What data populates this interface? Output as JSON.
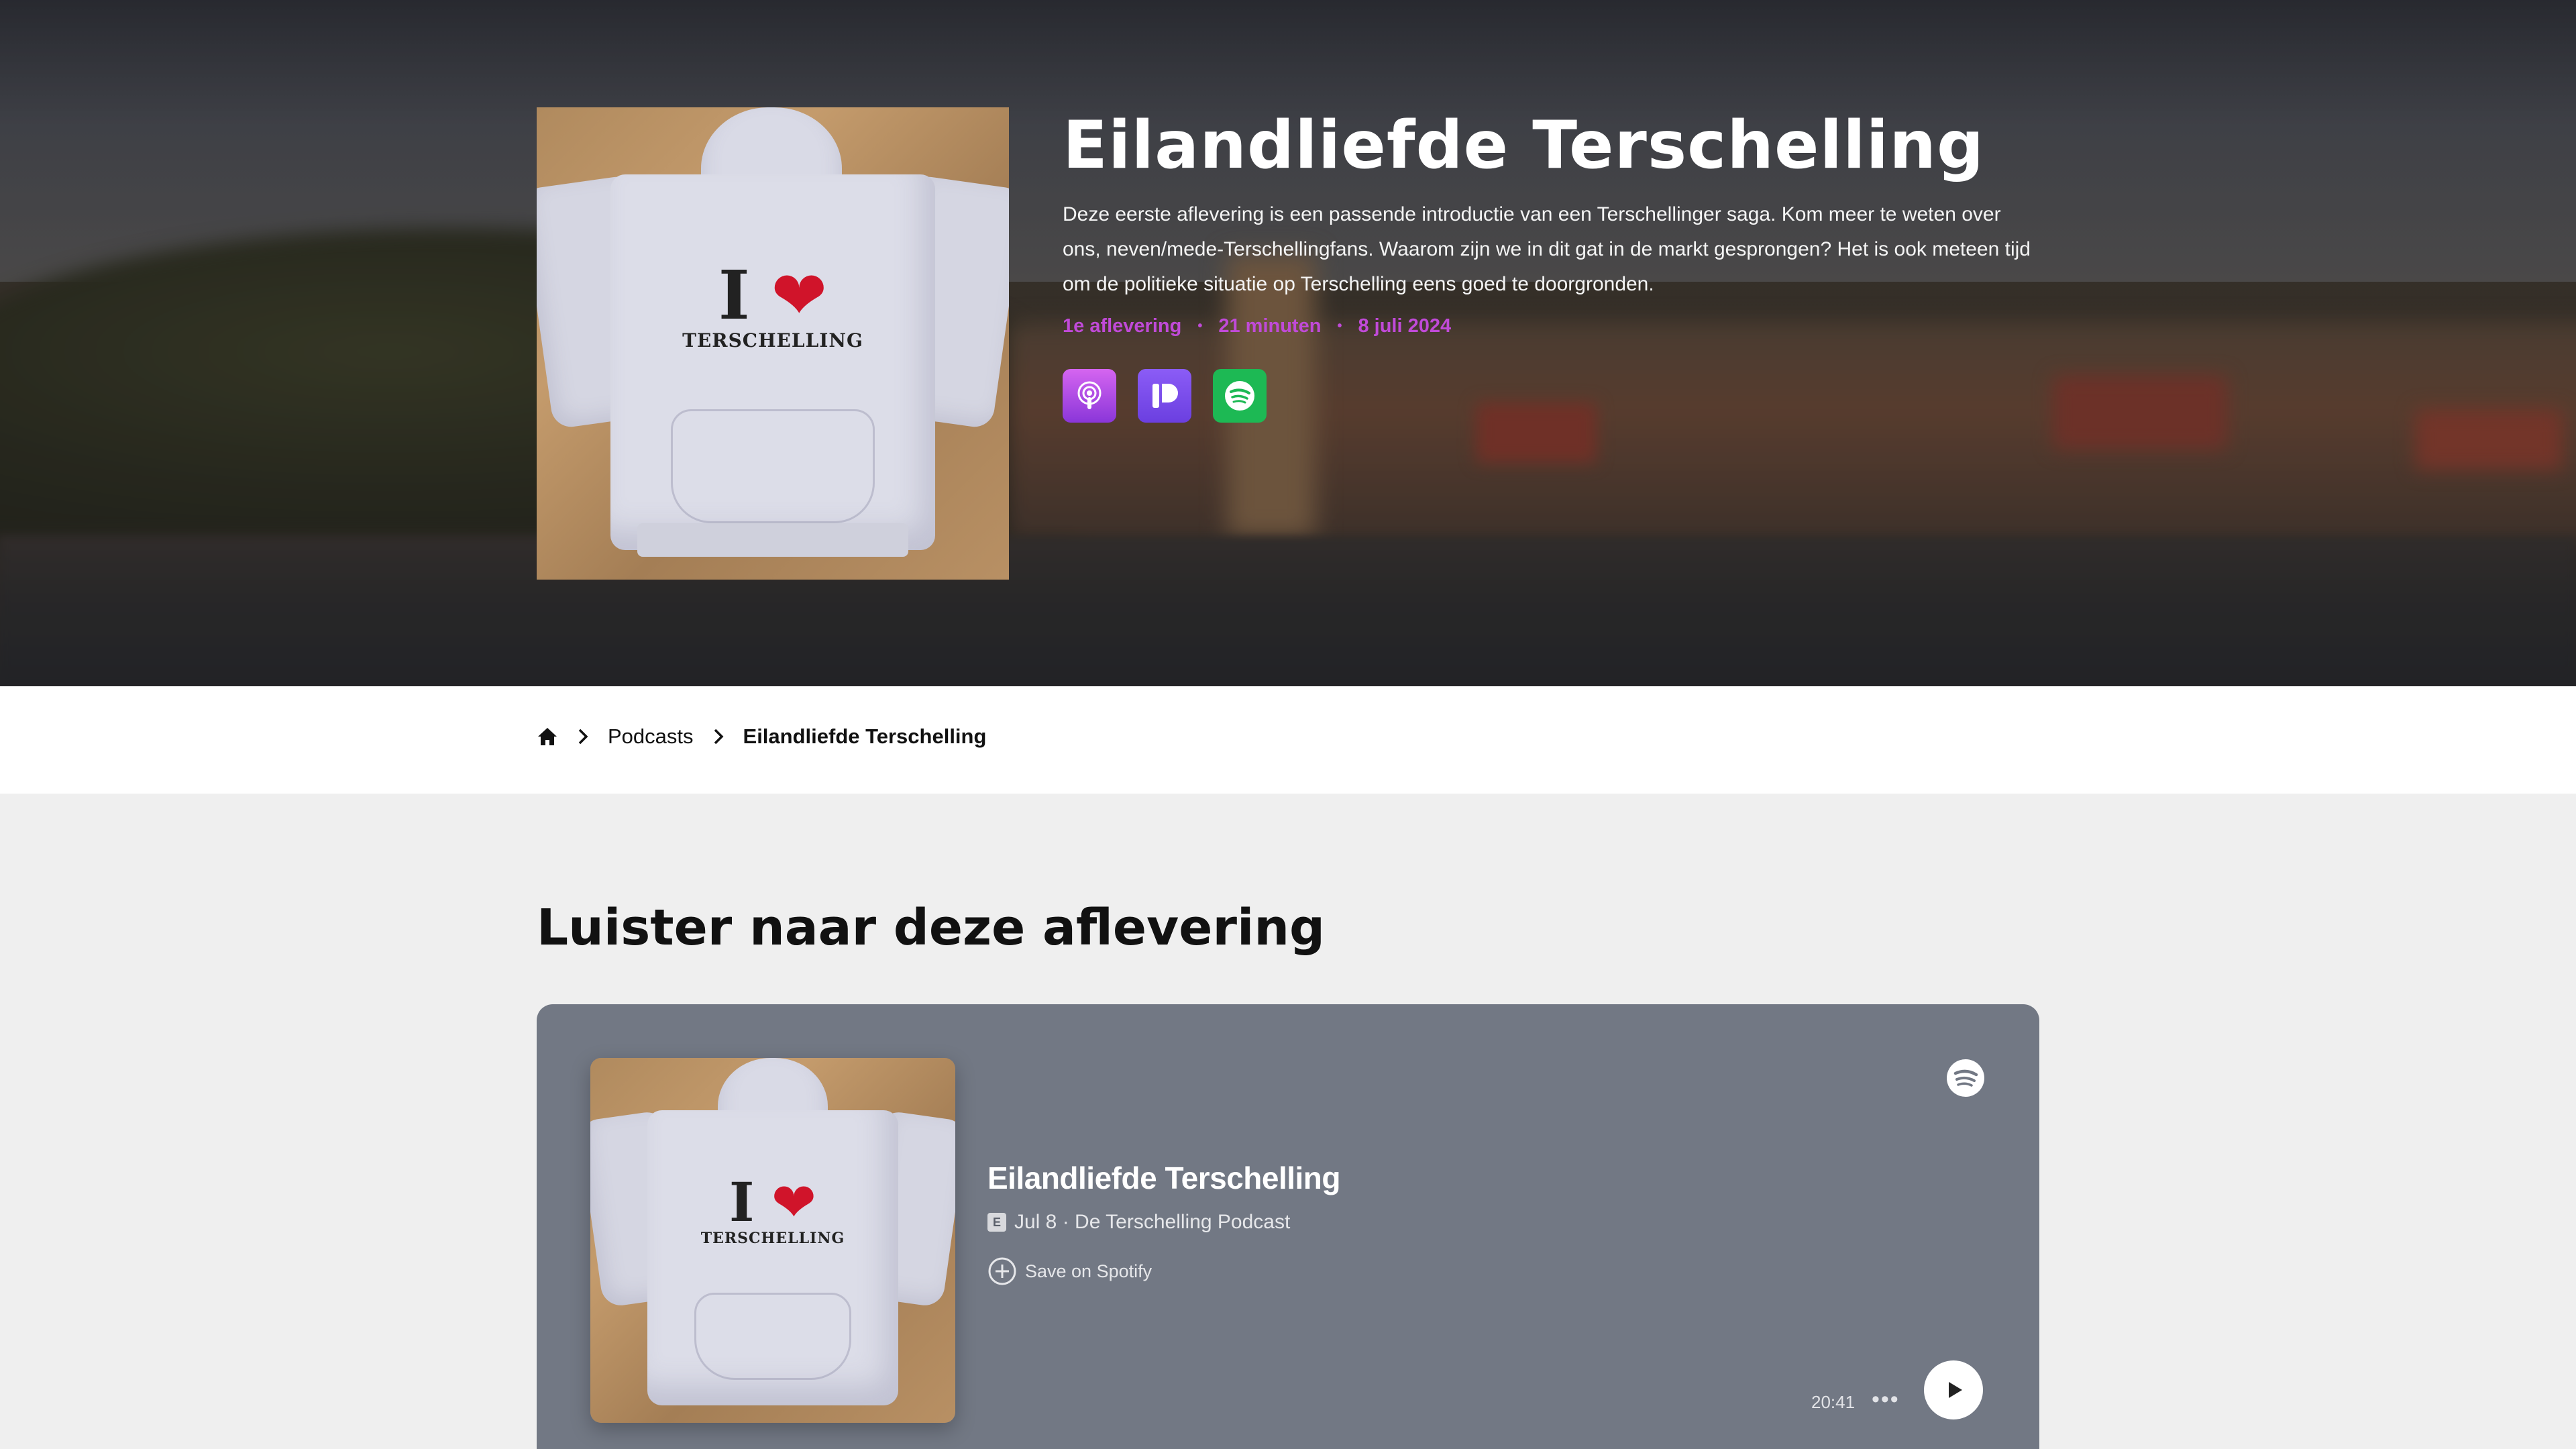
{
  "hero": {
    "title": "Eilandliefde Terschelling",
    "description": "Deze eerste aflevering is een passende introductie van een Terschellinger saga. Kom meer te weten over ons, neven/mede-Terschellingfans. Waarom zijn we in dit gat in de markt gesprongen? Het is ook meteen tijd om de politieke situatie op Terschelling eens goed te doorgronden.",
    "meta": {
      "episode": "1e aflevering",
      "duration": "21 minuten",
      "date": "8 juli 2024",
      "separator": "•"
    },
    "cover_print": {
      "letter": "I",
      "heart": "❤",
      "word": "TERSCHELLING"
    },
    "platforms": [
      {
        "icon": "apple-podcasts-icon",
        "color": "#b84ce6"
      },
      {
        "icon": "podbean-icon",
        "color": "#7b4cf0"
      },
      {
        "icon": "spotify-icon",
        "color": "#1db954"
      }
    ]
  },
  "breadcrumb": {
    "home_icon": "home-icon",
    "items": [
      "Podcasts",
      "Eilandliefde Terschelling"
    ]
  },
  "section": {
    "title": "Luister naar deze aflevering"
  },
  "embed": {
    "title": "Eilandliefde Terschelling",
    "explicit_badge": "E",
    "subtitle": "Jul 8 · De Terschelling Podcast",
    "save_label": "Save on Spotify",
    "duration": "20:41",
    "more": "•••",
    "background": "#727884"
  },
  "colors": {
    "accent": "#c04ad8"
  }
}
